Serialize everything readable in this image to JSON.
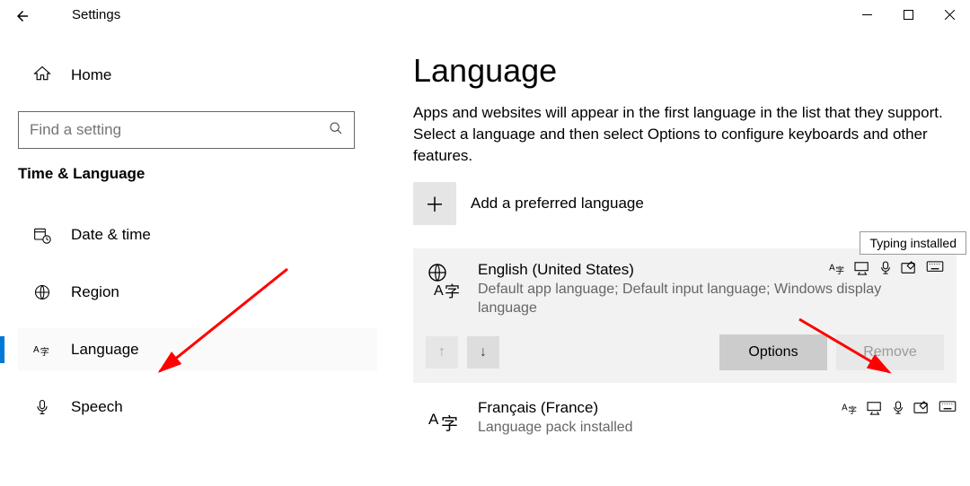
{
  "window": {
    "title": "Settings"
  },
  "sidebar": {
    "home": "Home",
    "searchPlaceholder": "Find a setting",
    "group": "Time & Language",
    "items": [
      {
        "label": "Date & time"
      },
      {
        "label": "Region"
      },
      {
        "label": "Language"
      },
      {
        "label": "Speech"
      }
    ]
  },
  "main": {
    "title": "Language",
    "desc": "Apps and websites will appear in the first language in the list that they support. Select a language and then select Options to configure keyboards and other features.",
    "addLabel": "Add a preferred language",
    "optionsLabel": "Options",
    "removeLabel": "Remove",
    "lang1": {
      "name": "English (United States)",
      "sub": "Default app language; Default input language; Windows display language"
    },
    "lang2": {
      "name": "Français (France)",
      "sub": "Language pack installed"
    }
  },
  "tooltip": "Typing installed"
}
